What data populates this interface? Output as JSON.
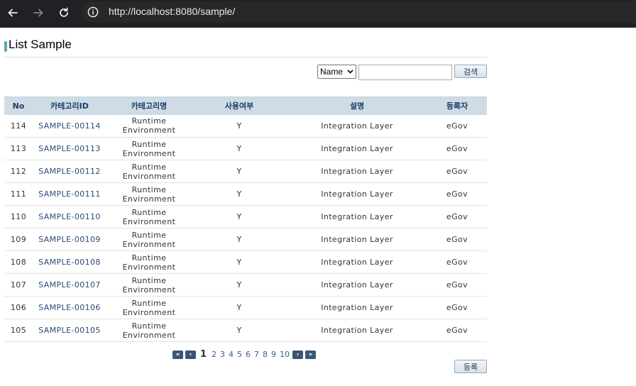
{
  "browser": {
    "url": "http://localhost:8080/sample/"
  },
  "page": {
    "title": "List Sample"
  },
  "search": {
    "condition_selected": "Name",
    "keyword_value": "",
    "search_label": "검색"
  },
  "table": {
    "headers": [
      "No",
      "카테고리ID",
      "카테고리명",
      "사용여부",
      "설명",
      "등록자"
    ],
    "rows": [
      [
        "114",
        "SAMPLE-00114",
        "Runtime Environment",
        "Y",
        "Integration Layer",
        "eGov"
      ],
      [
        "113",
        "SAMPLE-00113",
        "Runtime Environment",
        "Y",
        "Integration Layer",
        "eGov"
      ],
      [
        "112",
        "SAMPLE-00112",
        "Runtime Environment",
        "Y",
        "Integration Layer",
        "eGov"
      ],
      [
        "111",
        "SAMPLE-00111",
        "Runtime Environment",
        "Y",
        "Integration Layer",
        "eGov"
      ],
      [
        "110",
        "SAMPLE-00110",
        "Runtime Environment",
        "Y",
        "Integration Layer",
        "eGov"
      ],
      [
        "109",
        "SAMPLE-00109",
        "Runtime Environment",
        "Y",
        "Integration Layer",
        "eGov"
      ],
      [
        "108",
        "SAMPLE-00108",
        "Runtime Environment",
        "Y",
        "Integration Layer",
        "eGov"
      ],
      [
        "107",
        "SAMPLE-00107",
        "Runtime Environment",
        "Y",
        "Integration Layer",
        "eGov"
      ],
      [
        "106",
        "SAMPLE-00106",
        "Runtime Environment",
        "Y",
        "Integration Layer",
        "eGov"
      ],
      [
        "105",
        "SAMPLE-00105",
        "Runtime Environment",
        "Y",
        "Integration Layer",
        "eGov"
      ]
    ]
  },
  "pagination": {
    "current": "1",
    "pages": [
      "2",
      "3",
      "4",
      "5",
      "6",
      "7",
      "8",
      "9",
      "10"
    ],
    "first_icon": "double-left-arrow-icon",
    "prev_icon": "left-arrow-icon",
    "next_icon": "right-arrow-icon",
    "last_icon": "double-right-arrow-icon"
  },
  "actions": {
    "register_label": "등록"
  },
  "colors": {
    "header_bg": "#cfdce6",
    "header_text": "#1a3c64",
    "link_text": "#2b4a7a",
    "pager_button": "#3b5573"
  }
}
